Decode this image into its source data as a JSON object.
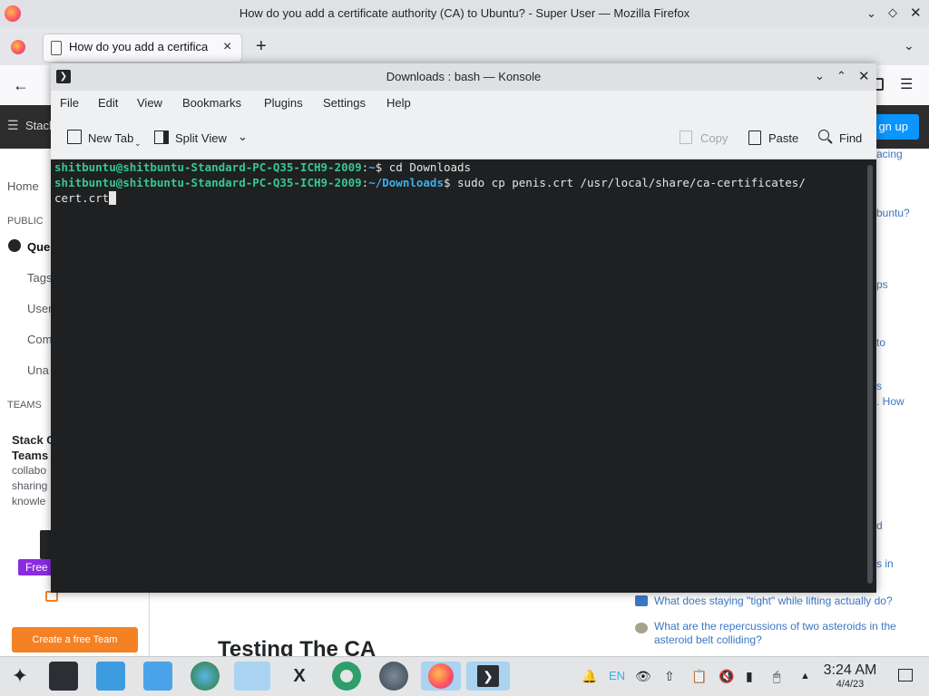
{
  "firefox": {
    "window_title": "How do you add a certificate authority (CA) to Ubuntu? - Super User — Mozilla Firefox",
    "tab_title": "How do you add a certifica",
    "new_tab_symbol": "+",
    "tab_close_symbol": "×"
  },
  "stackexchange": {
    "site_short": "Stack",
    "signup_label": "gn up",
    "left_nav": {
      "home": "Home",
      "public": "PUBLIC",
      "questions": "Que",
      "tags": "Tags",
      "users": "User",
      "companies": "Com",
      "unanswered": "Una",
      "teams": "TEAMS"
    },
    "teams_promo": {
      "title_1": "Stack C",
      "title_2": "Teams",
      "line_1": "collabo",
      "line_2": "sharing",
      "line_3": "knowle",
      "free_badge": "Free",
      "create_button": "Create a free Team"
    },
    "heading": "Testing The CA",
    "right_fragments": [
      "acing",
      "buntu?",
      "ps",
      "to",
      "s",
      ". How",
      "d",
      "s in"
    ],
    "hot_questions": [
      "What does staying \"tight\" while lifting actually do?",
      "What are the repercussions of two asteroids in the asteroid belt colliding?"
    ]
  },
  "konsole": {
    "title": "Downloads : bash — Konsole",
    "menu": [
      "File",
      "Edit",
      "View",
      "Bookmarks",
      "Plugins",
      "Settings",
      "Help"
    ],
    "toolbar": {
      "new_tab": "New Tab",
      "split_view": "Split View",
      "copy": "Copy",
      "paste": "Paste",
      "find": "Find"
    },
    "lines": [
      {
        "user": "shitbuntu@shitbuntu-Standard-PC-Q35-ICH9-2009",
        "sep": ":",
        "path": "~",
        "cmd": "$ cd Downloads"
      },
      {
        "user": "shitbuntu@shitbuntu-Standard-PC-Q35-ICH9-2009",
        "sep": ":",
        "path": "~/Downloads",
        "cmd": "$ sudo cp penis.crt /usr/local/share/ca-certificates/"
      }
    ],
    "continuation": "cert.crt"
  },
  "taskbar": {
    "time": "3:24 AM",
    "date": "4/4/23",
    "keyboard_layout": "EN",
    "icons": [
      "app-launcher-icon",
      "settings-icon",
      "discover-icon",
      "files-icon",
      "browser-globe-icon",
      "krita-icon",
      "x-icon",
      "app-green-icon",
      "app-gear-icon",
      "firefox-icon",
      "konsole-icon"
    ]
  }
}
